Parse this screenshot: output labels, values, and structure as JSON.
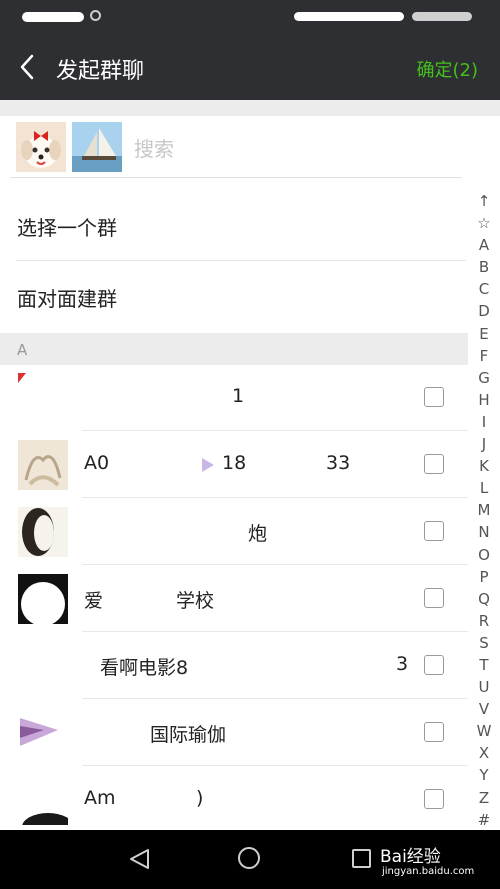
{
  "header": {
    "title": "发起群聊",
    "confirm_label": "确定(2)",
    "accent_color": "#45c01a",
    "background_color": "#2e2f33"
  },
  "search": {
    "placeholder": "搜索",
    "selected_avatars": [
      "dog-photo",
      "sailboat-photo"
    ]
  },
  "menu": [
    {
      "label": "选择一个群"
    },
    {
      "label": "面对面建群"
    }
  ],
  "section_header": "A",
  "contacts": [
    {
      "name": "1"
    },
    {
      "name": "A0",
      "name_tail": "18",
      "name_end": "33"
    },
    {
      "name": "",
      "name_tail": "炮"
    },
    {
      "name": "爱",
      "name_tail": "学校"
    },
    {
      "name": "看啊电影8",
      "name_end": "3"
    },
    {
      "name": "",
      "name_tail": "国际瑜伽"
    },
    {
      "name": "Am",
      "name_tail": ")"
    }
  ],
  "index_letters": [
    "↑",
    "☆",
    "A",
    "B",
    "C",
    "D",
    "E",
    "F",
    "G",
    "H",
    "I",
    "J",
    "K",
    "L",
    "M",
    "N",
    "O",
    "P",
    "Q",
    "R",
    "S",
    "T",
    "U",
    "V",
    "W",
    "X",
    "Y",
    "Z",
    "#"
  ],
  "watermark": {
    "brand": "Bai经验",
    "url": "jingyan.baidu.com"
  }
}
